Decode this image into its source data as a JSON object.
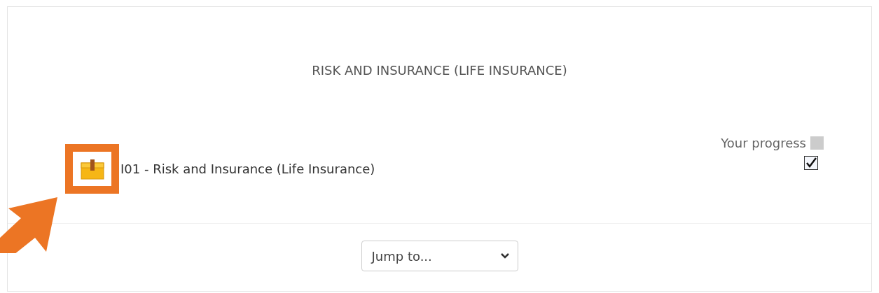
{
  "section": {
    "title": "RISK AND INSURANCE (LIFE INSURANCE)"
  },
  "activity": {
    "name": "I01 - Risk and Insurance (Life Insurance)",
    "checked": true,
    "highlighted": true
  },
  "progress": {
    "label": "Your progress"
  },
  "jump_menu": {
    "value": "Jump to..."
  }
}
